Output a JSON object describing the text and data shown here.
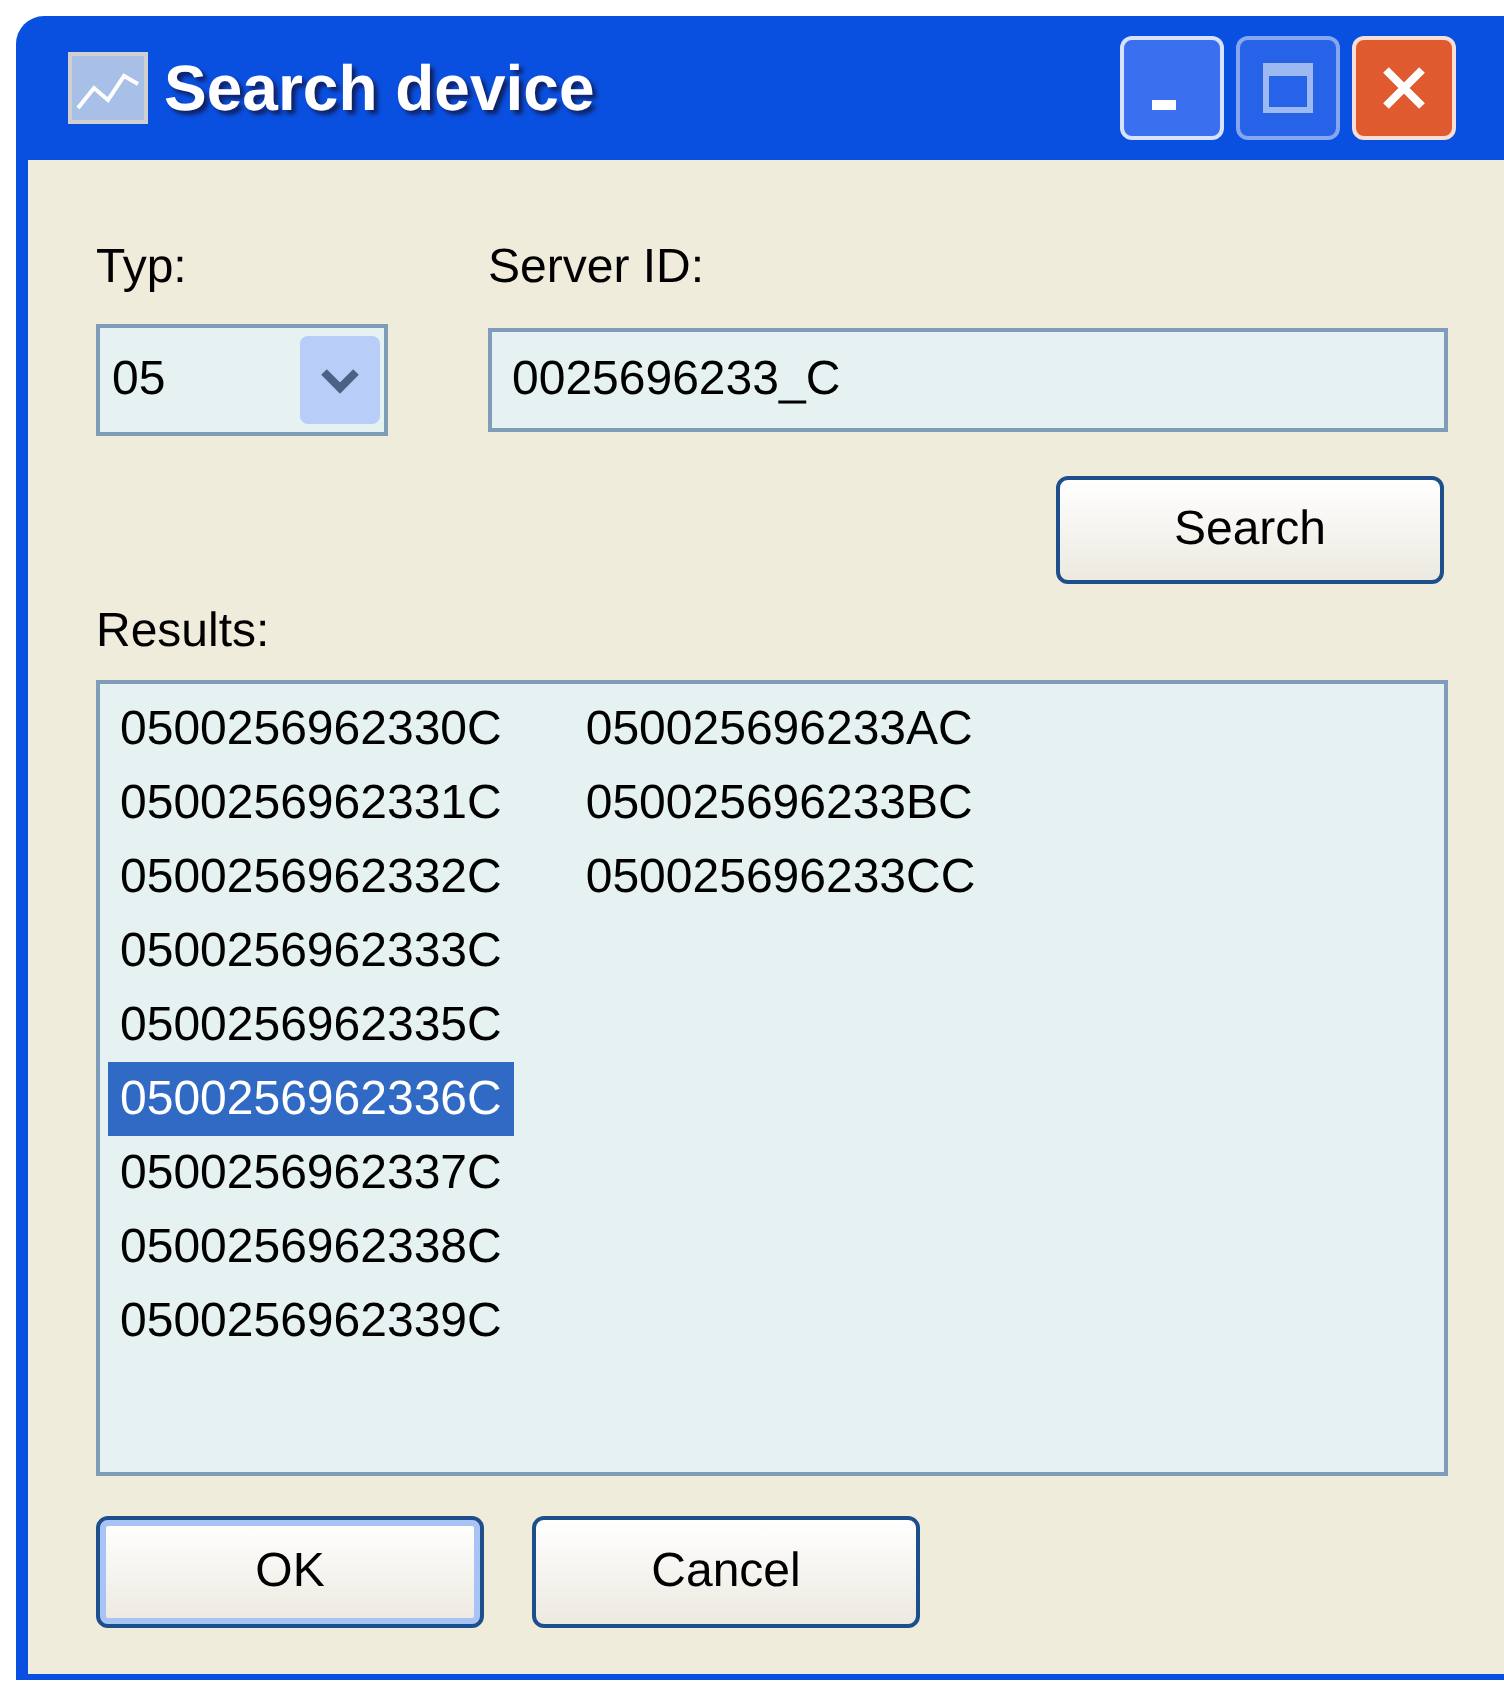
{
  "window": {
    "title": "Search device",
    "controls": [
      {
        "kind": "minimize"
      },
      {
        "kind": "maximize"
      },
      {
        "kind": "close"
      }
    ]
  },
  "typ": {
    "label": "Typ:",
    "value": "05"
  },
  "server_id": {
    "label": "Server ID:",
    "value": "0025696233_C"
  },
  "search_button": "Search",
  "results": {
    "label": "Results:",
    "items": [
      {
        "text": "0500256962330C",
        "selected": false
      },
      {
        "text": "0500256962331C",
        "selected": false
      },
      {
        "text": "0500256962332C",
        "selected": false
      },
      {
        "text": "0500256962333C",
        "selected": false
      },
      {
        "text": "0500256962335C",
        "selected": false
      },
      {
        "text": "0500256962336C",
        "selected": true
      },
      {
        "text": "0500256962337C",
        "selected": false
      },
      {
        "text": "0500256962338C",
        "selected": false
      },
      {
        "text": "0500256962339C",
        "selected": false
      },
      {
        "text": "050025696233AC",
        "selected": false
      },
      {
        "text": "050025696233BC",
        "selected": false
      },
      {
        "text": "050025696233CC",
        "selected": false
      }
    ]
  },
  "buttons": [
    {
      "label": "OK",
      "default": true
    },
    {
      "label": "Cancel",
      "default": false
    }
  ]
}
